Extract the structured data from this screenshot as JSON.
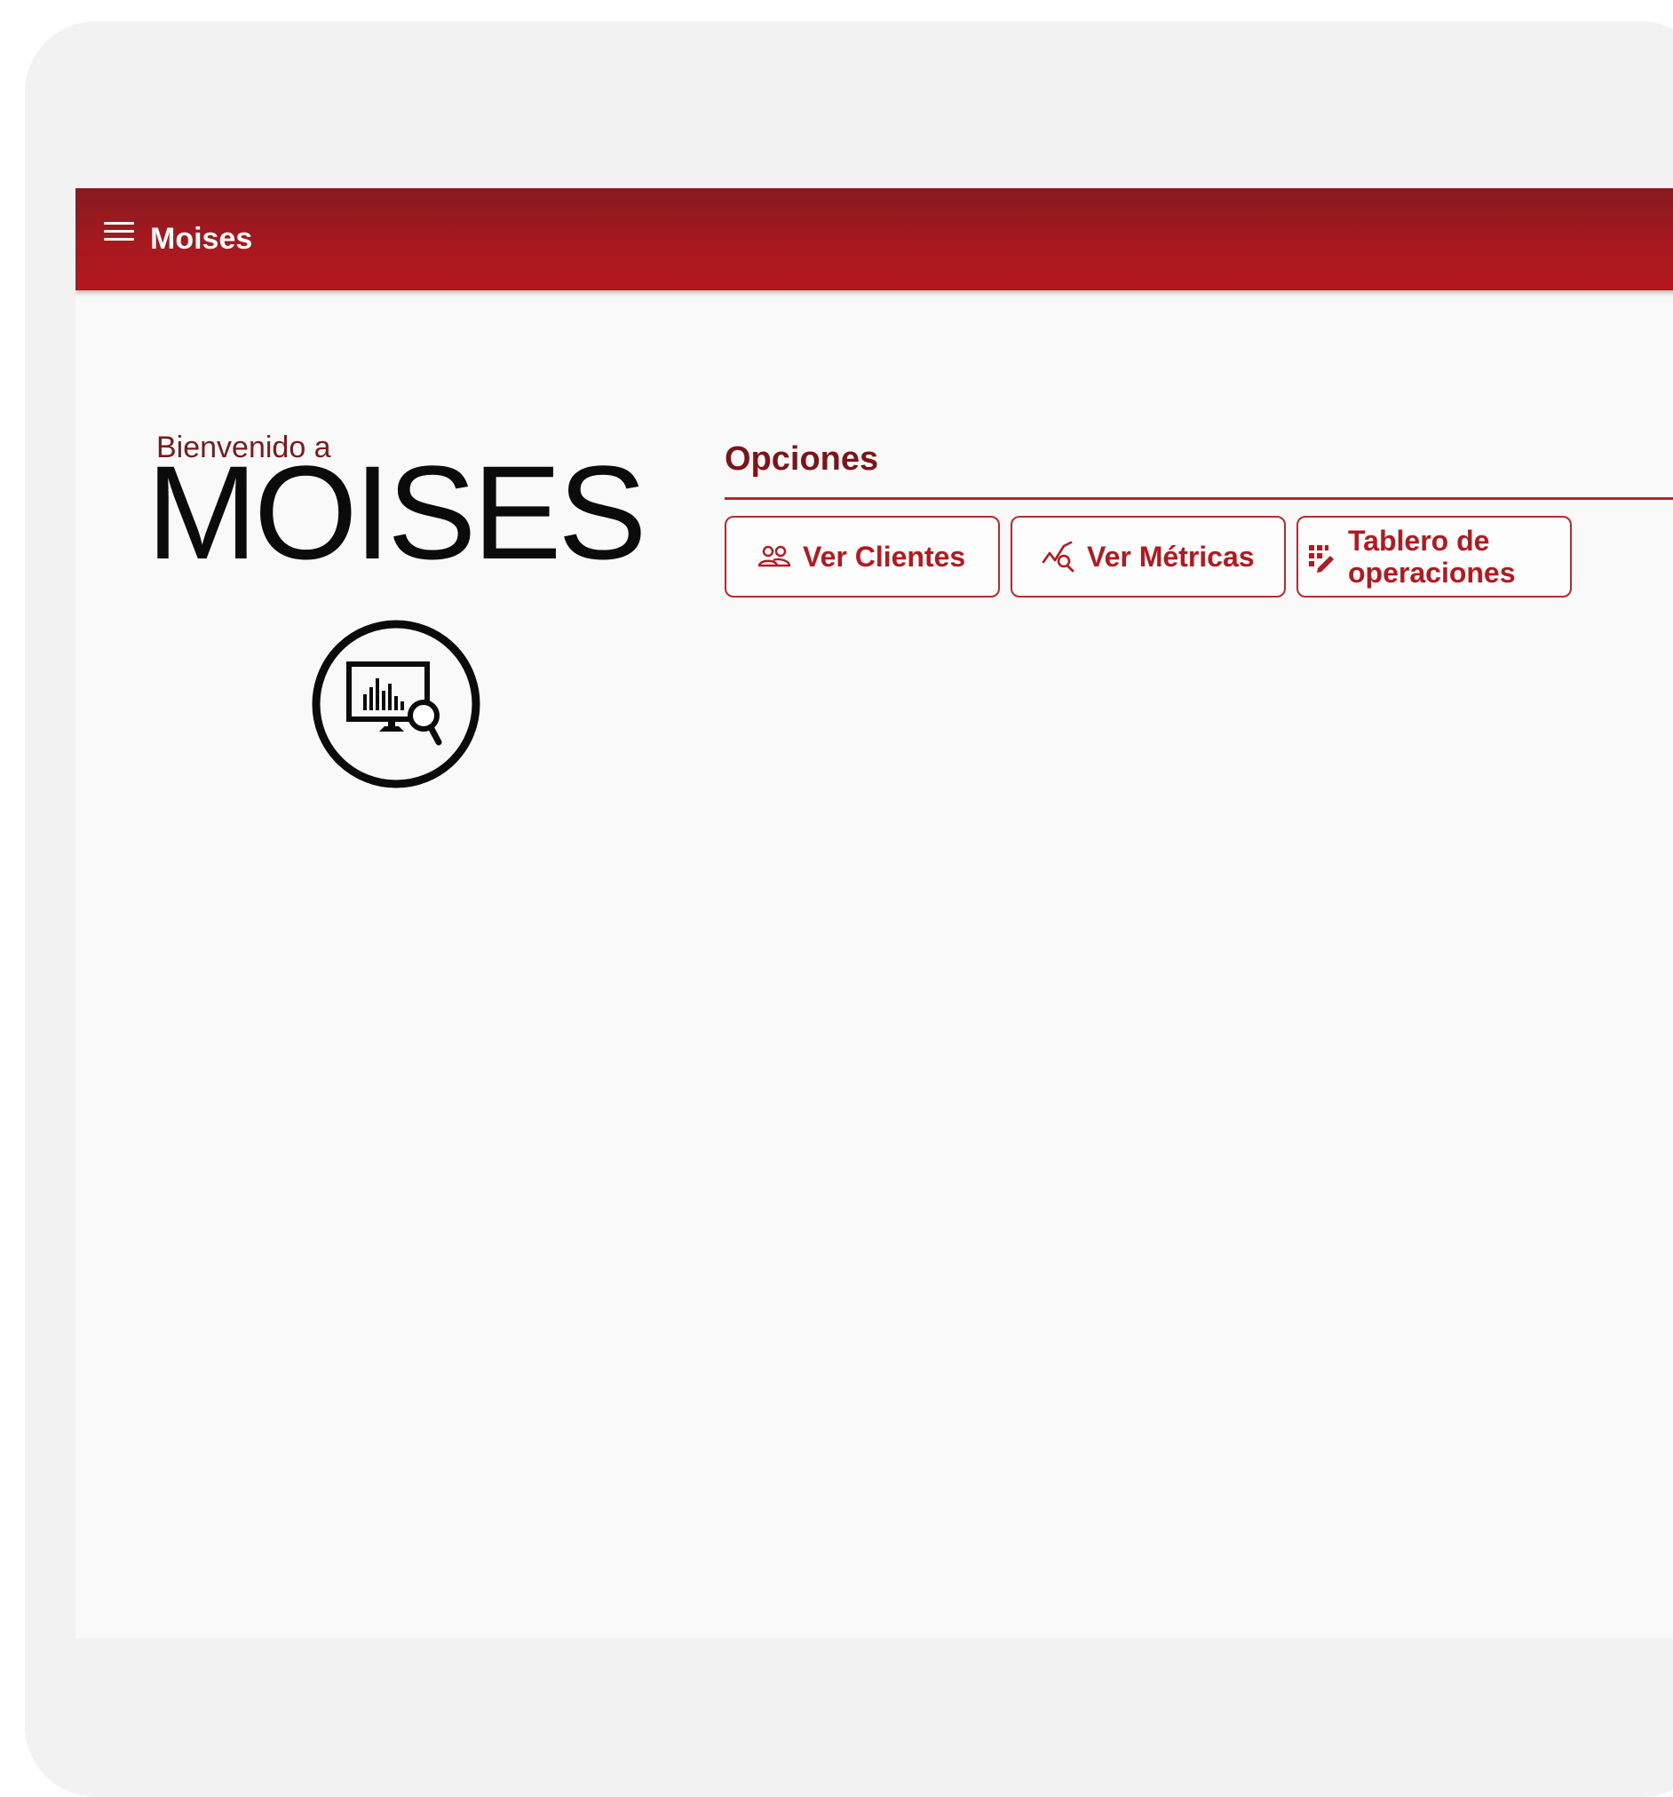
{
  "appbar": {
    "title": "Moises",
    "menu_icon": "hamburger-menu-icon",
    "background": "#a7191f"
  },
  "logo": {
    "subtitle": "Bienvenido a",
    "title": "MOISES",
    "emblem_icon": "monitor-chart-magnifier-icon"
  },
  "options": {
    "title": "Opciones",
    "buttons": [
      {
        "label": "Ver Clientes",
        "icon": "users-icon"
      },
      {
        "label": "Ver Métricas",
        "icon": "chart-search-icon"
      },
      {
        "label": "Tablero de operaciones",
        "icon": "dashboard-grid-icon"
      }
    ]
  },
  "colors": {
    "accent": "#b3191f",
    "accent_dark": "#7f1418",
    "surface": "#f9f9f9"
  }
}
